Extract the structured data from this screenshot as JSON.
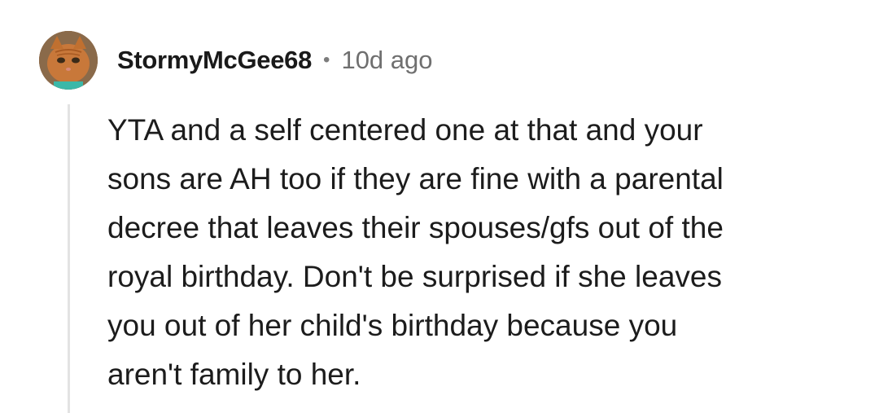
{
  "comment": {
    "author": "StormyMcGee68",
    "separator": "•",
    "time_ago": "10d ago",
    "avatar_icon": "orange-kitten-avatar",
    "body_lines": [
      "YTA and a self centered one at that and your",
      "sons are AH too if they are fine with a parental",
      "decree that leaves their spouses/gfs out of the",
      "royal birthday.  Don't be surprised if she leaves",
      "you out of her child's birthday because you",
      "aren't family to her."
    ]
  }
}
